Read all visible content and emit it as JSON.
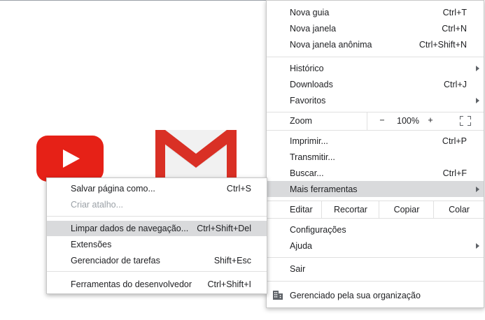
{
  "menu": {
    "items_top": [
      {
        "label": "Nova guia",
        "shortcut": "Ctrl+T"
      },
      {
        "label": "Nova janela",
        "shortcut": "Ctrl+N"
      },
      {
        "label": "Nova janela anônima",
        "shortcut": "Ctrl+Shift+N"
      }
    ],
    "items_history": [
      {
        "label": "Histórico"
      },
      {
        "label": "Downloads",
        "shortcut": "Ctrl+J"
      },
      {
        "label": "Favoritos"
      }
    ],
    "zoom": {
      "label": "Zoom",
      "minus": "−",
      "value": "100%",
      "plus": "+"
    },
    "items_tools": [
      {
        "label": "Imprimir...",
        "shortcut": "Ctrl+P"
      },
      {
        "label": "Transmitir..."
      },
      {
        "label": "Buscar...",
        "shortcut": "Ctrl+F"
      },
      {
        "label": "Mais ferramentas"
      }
    ],
    "edit": {
      "label": "Editar",
      "cut": "Recortar",
      "copy": "Copiar",
      "paste": "Colar"
    },
    "items_settings": [
      {
        "label": "Configurações"
      },
      {
        "label": "Ajuda"
      }
    ],
    "exit": {
      "label": "Sair"
    },
    "managed": {
      "label": "Gerenciado pela sua organização"
    }
  },
  "submenu": {
    "items": [
      {
        "label": "Salvar página como...",
        "shortcut": "Ctrl+S"
      },
      {
        "label": "Criar atalho..."
      },
      {
        "label": "Limpar dados de navegação...",
        "shortcut": "Ctrl+Shift+Del"
      },
      {
        "label": "Extensões"
      },
      {
        "label": "Gerenciador de tarefas",
        "shortcut": "Shift+Esc"
      },
      {
        "label": "Ferramentas do desenvolvedor",
        "shortcut": "Ctrl+Shift+I"
      }
    ]
  },
  "colors": {
    "highlight": "#d9dadc",
    "youtube": "#e62117",
    "gmail": "#d93025"
  }
}
